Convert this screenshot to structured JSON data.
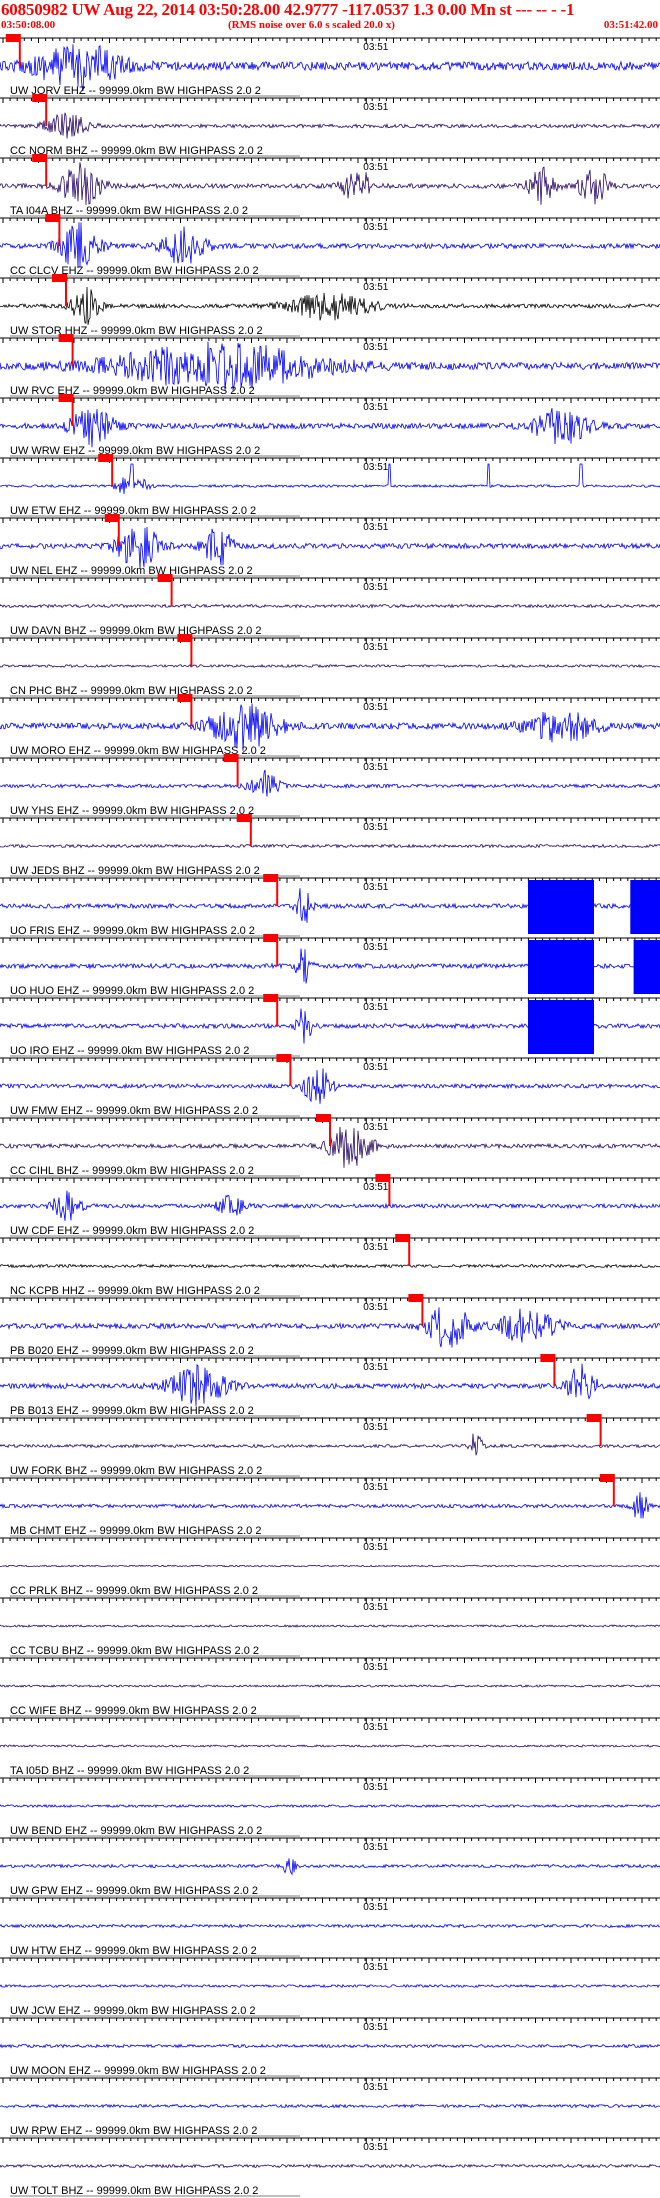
{
  "header": {
    "title": "60850982 UW Aug 22, 2014 03:50:28.00   42.9777 -117.0537  1.3 0.00 Mn st --- -- -  -1",
    "start_time": "03:50:08.00",
    "note": "(RMS noise over 6.0 s scaled 20.0 x)",
    "end_time": "03:51:42.00"
  },
  "minute_label": "03:51",
  "colors": {
    "trace_blue": "#0000ff",
    "trace_purple": "#2a0a6a",
    "trace_black": "#000000",
    "pick": "#ff0000",
    "text": "#000000",
    "header_text": "#ff0000"
  },
  "traces": [
    {
      "label": "UW JORV EHZ -- 99999.0km BW  HIGHPASS  2.0  2",
      "color": "blue",
      "amp": 0.85,
      "pick": 0.03,
      "bursts": [
        [
          0.12,
          0.06,
          1.0
        ]
      ]
    },
    {
      "label": "CC NORM BHZ -- 99999.0km BW  HIGHPASS  2.0  2",
      "color": "purple",
      "amp": 0.35,
      "pick": 0.07,
      "bursts": [
        [
          0.1,
          0.03,
          0.6
        ]
      ]
    },
    {
      "label": "TA I04A BHZ -- 99999.0km BW  HIGHPASS  2.0  2",
      "color": "purple",
      "amp": 0.45,
      "pick": 0.07,
      "bursts": [
        [
          0.12,
          0.03,
          1.0
        ],
        [
          0.54,
          0.02,
          0.9
        ],
        [
          0.82,
          0.02,
          0.8
        ],
        [
          0.9,
          0.02,
          0.9
        ]
      ]
    },
    {
      "label": "CC CLCV EHZ -- 99999.0km BW  HIGHPASS  2.0  2",
      "color": "blue",
      "amp": 0.5,
      "pick": 0.09,
      "bursts": [
        [
          0.12,
          0.03,
          1.0
        ],
        [
          0.28,
          0.03,
          0.9
        ]
      ]
    },
    {
      "label": "UW STOR HHZ -- 99999.0km BW  HIGHPASS  2.0  2",
      "color": "black",
      "amp": 0.4,
      "pick": 0.1,
      "bursts": [
        [
          0.13,
          0.02,
          0.8
        ],
        [
          0.5,
          0.06,
          0.6
        ]
      ]
    },
    {
      "label": "UW RVC EHZ -- 99999.0km BW  HIGHPASS  2.0  2",
      "color": "blue",
      "amp": 0.7,
      "pick": 0.11,
      "bursts": [
        [
          0.33,
          0.15,
          1.0
        ]
      ]
    },
    {
      "label": "UW WRW EHZ -- 99999.0km BW  HIGHPASS  2.0  2",
      "color": "blue",
      "amp": 0.55,
      "pick": 0.11,
      "bursts": [
        [
          0.14,
          0.03,
          0.9
        ],
        [
          0.85,
          0.04,
          0.8
        ]
      ]
    },
    {
      "label": "UW ETW EHZ -- 99999.0km BW  HIGHPASS  2.0  2",
      "color": "blue",
      "amp": 0.25,
      "pick": 0.17,
      "bursts": [
        [
          0.2,
          0.02,
          0.6
        ]
      ],
      "spikes": [
        0.2,
        0.59,
        0.74,
        0.88
      ]
    },
    {
      "label": "UW NEL EHZ -- 99999.0km BW  HIGHPASS  2.0  2",
      "color": "blue",
      "amp": 0.5,
      "pick": 0.18,
      "bursts": [
        [
          0.21,
          0.03,
          1.0
        ],
        [
          0.33,
          0.02,
          0.9
        ]
      ]
    },
    {
      "label": "UW DAVN BHZ -- 99999.0km BW  HIGHPASS  2.0  2",
      "color": "purple",
      "amp": 0.3,
      "pick": 0.26,
      "bursts": []
    },
    {
      "label": "CN PHC BHZ -- 99999.0km BW  HIGHPASS  2.0  2",
      "color": "purple",
      "amp": 0.25,
      "pick": 0.29,
      "bursts": []
    },
    {
      "label": "UW MORO EHZ -- 99999.0km BW  HIGHPASS  2.0  2",
      "color": "blue",
      "amp": 0.6,
      "pick": 0.29,
      "bursts": [
        [
          0.37,
          0.05,
          1.0
        ],
        [
          0.85,
          0.05,
          0.7
        ]
      ]
    },
    {
      "label": "UW YHS EHZ -- 99999.0km BW  HIGHPASS  2.0  2",
      "color": "blue",
      "amp": 0.35,
      "pick": 0.36,
      "bursts": [
        [
          0.4,
          0.02,
          0.7
        ]
      ]
    },
    {
      "label": "UW JEDS BHZ -- 99999.0km BW  HIGHPASS  2.0  2",
      "color": "purple",
      "amp": 0.3,
      "pick": 0.38,
      "bursts": []
    },
    {
      "label": "UO FRIS EHZ -- 99999.0km BW  HIGHPASS  2.0  2",
      "color": "blue",
      "amp": 0.45,
      "pick": 0.42,
      "bursts": [
        [
          0.46,
          0.01,
          1.0
        ]
      ],
      "blocks": [
        [
          0.8,
          0.9
        ],
        [
          0.955,
          1.0
        ]
      ]
    },
    {
      "label": "UO HUO EHZ -- 99999.0km BW  HIGHPASS  2.0  2",
      "color": "blue",
      "amp": 0.45,
      "pick": 0.42,
      "bursts": [
        [
          0.46,
          0.01,
          1.0
        ]
      ],
      "blocks": [
        [
          0.8,
          0.9
        ],
        [
          0.96,
          1.0
        ]
      ]
    },
    {
      "label": "UO IRO EHZ -- 99999.0km BW  HIGHPASS  2.0  2",
      "color": "blue",
      "amp": 0.45,
      "pick": 0.42,
      "bursts": [
        [
          0.46,
          0.01,
          1.0
        ]
      ],
      "blocks": [
        [
          0.8,
          0.9
        ]
      ]
    },
    {
      "label": "UW FMW EHZ -- 99999.0km BW  HIGHPASS  2.0  2",
      "color": "blue",
      "amp": 0.4,
      "pick": 0.44,
      "bursts": [
        [
          0.48,
          0.02,
          0.9
        ]
      ]
    },
    {
      "label": "CC CIHL BHZ -- 99999.0km BW  HIGHPASS  2.0  2",
      "color": "purple",
      "amp": 0.4,
      "pick": 0.5,
      "bursts": [
        [
          0.53,
          0.03,
          1.0
        ]
      ]
    },
    {
      "label": "UW CDF EHZ -- 99999.0km BW  HIGHPASS  2.0  2",
      "color": "blue",
      "amp": 0.4,
      "pick": 0.59,
      "bursts": [
        [
          0.1,
          0.02,
          0.7
        ],
        [
          0.35,
          0.02,
          0.5
        ]
      ]
    },
    {
      "label": "NC KCPB HHZ -- 99999.0km BW  HIGHPASS  2.0  2",
      "color": "black",
      "amp": 0.3,
      "pick": 0.62,
      "bursts": []
    },
    {
      "label": "PB B020 EHZ -- 99999.0km BW  HIGHPASS  2.0  2",
      "color": "blue",
      "amp": 0.5,
      "pick": 0.64,
      "bursts": [
        [
          0.68,
          0.03,
          1.0
        ],
        [
          0.8,
          0.04,
          0.8
        ]
      ]
    },
    {
      "label": "PB B013 EHZ -- 99999.0km BW  HIGHPASS  2.0  2",
      "color": "blue",
      "amp": 0.5,
      "pick": 0.84,
      "bursts": [
        [
          0.3,
          0.04,
          0.9
        ],
        [
          0.88,
          0.02,
          1.0
        ]
      ]
    },
    {
      "label": "UW FORK BHZ -- 99999.0km BW  HIGHPASS  2.0  2",
      "color": "purple",
      "amp": 0.3,
      "pick": 0.91,
      "bursts": [
        [
          0.72,
          0.01,
          0.6
        ]
      ]
    },
    {
      "label": "MB CHMT EHZ -- 99999.0km BW  HIGHPASS  2.0  2",
      "color": "blue",
      "amp": 0.35,
      "pick": 0.93,
      "bursts": [
        [
          0.97,
          0.01,
          0.9
        ]
      ]
    },
    {
      "label": "CC PRLK BHZ -- 99999.0km BW  HIGHPASS  2.0  2",
      "color": "purple",
      "amp": 0.15,
      "bursts": []
    },
    {
      "label": "CC TCBU BHZ -- 99999.0km BW  HIGHPASS  2.0  2",
      "color": "purple",
      "amp": 0.2,
      "bursts": []
    },
    {
      "label": "CC WIFE BHZ -- 99999.0km BW  HIGHPASS  2.0  2",
      "color": "purple",
      "amp": 0.2,
      "bursts": []
    },
    {
      "label": "TA I05D BHZ -- 99999.0km BW  HIGHPASS  2.0  2",
      "color": "purple",
      "amp": 0.2,
      "bursts": []
    },
    {
      "label": "UW BEND EHZ -- 99999.0km BW  HIGHPASS  2.0  2",
      "color": "blue",
      "amp": 0.25,
      "bursts": []
    },
    {
      "label": "UW GPW EHZ -- 99999.0km BW  HIGHPASS  2.0  2",
      "color": "blue",
      "amp": 0.3,
      "bursts": [
        [
          0.44,
          0.01,
          0.5
        ]
      ]
    },
    {
      "label": "UW HTW EHZ -- 99999.0km BW  HIGHPASS  2.0  2",
      "color": "blue",
      "amp": 0.3,
      "bursts": []
    },
    {
      "label": "UW JCW EHZ -- 99999.0km BW  HIGHPASS  2.0  2",
      "color": "blue",
      "amp": 0.25,
      "bursts": []
    },
    {
      "label": "UW MOON EHZ -- 99999.0km BW  HIGHPASS  2.0  2",
      "color": "blue",
      "amp": 0.3,
      "bursts": []
    },
    {
      "label": "UW RPW EHZ -- 99999.0km BW  HIGHPASS  2.0  2",
      "color": "blue",
      "amp": 0.3,
      "bursts": []
    },
    {
      "label": "UW TOLT BHZ -- 99999.0km BW  HIGHPASS  2.0  2",
      "color": "purple",
      "amp": 0.3,
      "bursts": []
    }
  ]
}
